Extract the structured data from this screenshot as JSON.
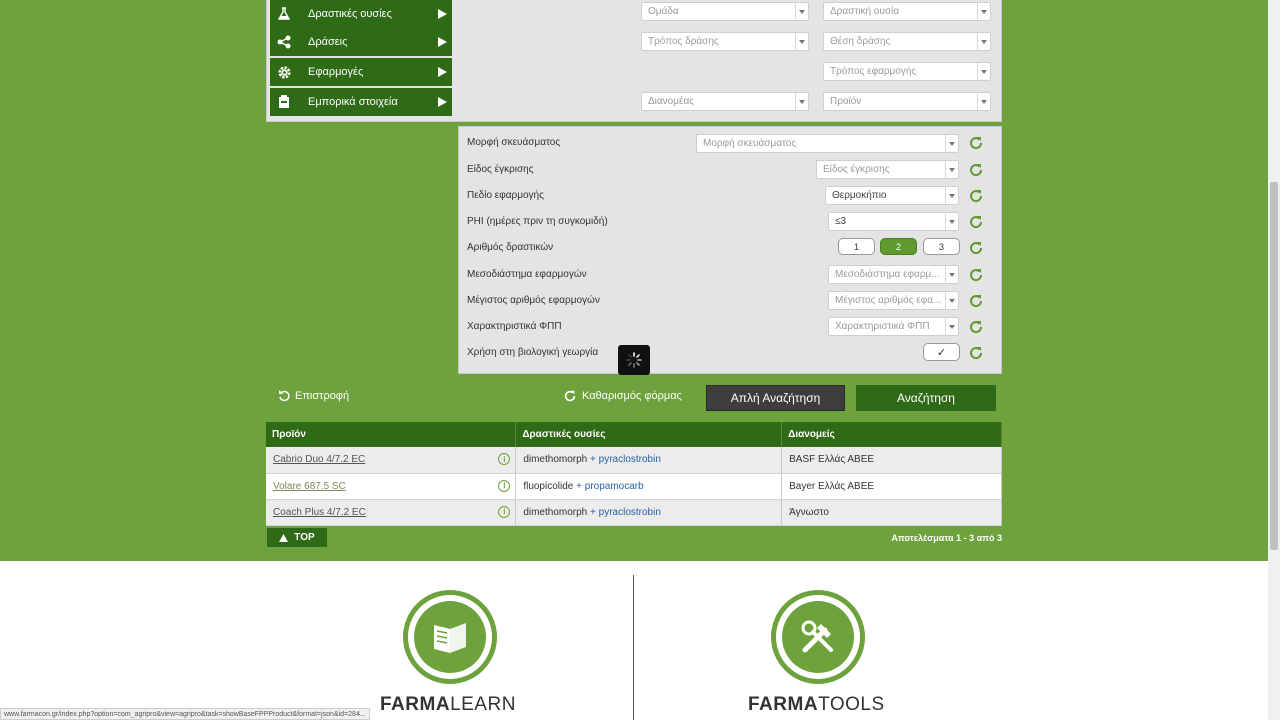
{
  "categories": [
    {
      "label": "Δραστικές ουσίες",
      "icon": "flask-icon"
    },
    {
      "label": "Δράσεις",
      "icon": "share-icon"
    },
    {
      "label": "Εφαρμογές",
      "icon": "gear-icon"
    },
    {
      "label": "Εμπορικά στοιχεία",
      "icon": "package-icon"
    }
  ],
  "top_selects": {
    "group": "Ομάδα",
    "active_substance": "Δραστική ουσία",
    "mode_of_action": "Τρόπος δράσης",
    "site_of_action": "Θέση δράσης",
    "application_method": "Τρόπος εφαρμογής",
    "distributor": "Διανομέας",
    "product": "Προϊόν"
  },
  "filters": {
    "formulation": {
      "label": "Μορφή σκευάσματος",
      "value": "Μορφή σκευάσματος"
    },
    "approval_type": {
      "label": "Είδος έγκρισης",
      "value": "Είδος έγκρισης"
    },
    "field": {
      "label": "Πεδίο εφαρμογής",
      "value": "Θερμοκήπιο"
    },
    "phi": {
      "label": "PHI (ημέρες πριν τη συγκομιδή)",
      "value": "≤3"
    },
    "num_actives": {
      "label": "Αριθμός δραστικών",
      "options": [
        "1",
        "2",
        "3"
      ],
      "selected": "2"
    },
    "interval": {
      "label": "Μεσοδιάστημα εφαρμογών",
      "value": "Μεσοδιάστημα εφαρμ..."
    },
    "max_apps": {
      "label": "Μέγιστος αριθμός εφαρμογών",
      "value": "Μέγιστος αριθμός εφα..."
    },
    "characteristics": {
      "label": "Χαρακτηριστικά ΦΠΠ",
      "value": "Χαρακτηριστικά ΦΠΠ"
    },
    "organic": {
      "label": "Χρήση στη βιολογική γεωργία",
      "value": "✓"
    }
  },
  "actions": {
    "back": "Επιστροφή",
    "clear": "Καθαρισμός φόρμας",
    "simple_search": "Απλή Αναζήτηση",
    "search": "Αναζήτηση"
  },
  "table": {
    "headers": [
      "Προϊόν",
      "Δραστικές ουσίες",
      "Διανομείς"
    ],
    "rows": [
      {
        "product": "Cabrio Duo 4/7.2 EC",
        "sub1": "dimethomorph",
        "plus": "+",
        "sub2": "pyraclostrobin",
        "distributor": "BASF Ελλάς ΑΒΕΕ"
      },
      {
        "product": "Volare 687.5 SC",
        "sub1": "fluopicolide",
        "plus": "+",
        "sub2": "propamocarb",
        "distributor": "Bayer Ελλάς ΑΒΕΕ"
      },
      {
        "product": "Coach Plus 4/7.2 EC",
        "sub1": "dimethomorph",
        "plus": "+",
        "sub2": "pyraclostrobin",
        "distributor": "Άγνωστο"
      }
    ]
  },
  "top_button": "TOP",
  "results_count": "Αποτελέσματα 1 - 3 από 3",
  "footer": {
    "brand1_bold": "FARMA",
    "brand1_rest": "LEARN",
    "brand2_bold": "FARMA",
    "brand2_rest": "TOOLS"
  },
  "status_url": "www.farmacon.gr/index.php?option=com_agripro&view=agripro&task=showBaseFPPProduct&format=json&id=284...",
  "colors": {
    "bg_green": "#6ea23c",
    "dark_green": "#2f6b17",
    "panel_gray": "#e4e4e4"
  }
}
